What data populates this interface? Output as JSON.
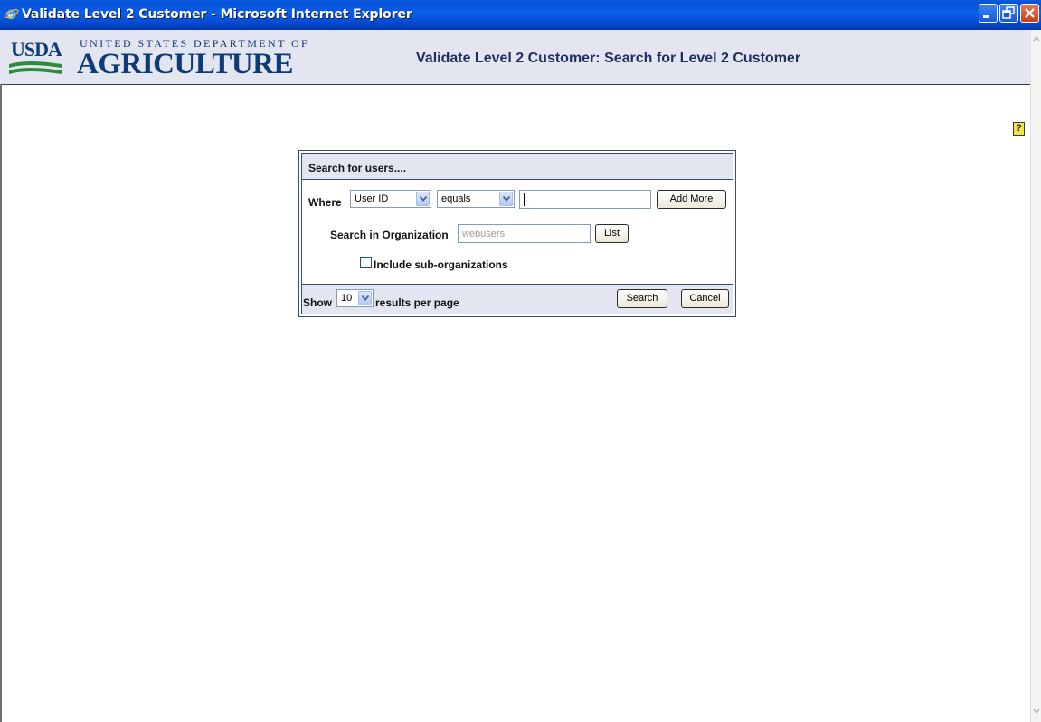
{
  "window": {
    "title": "Validate Level 2 Customer - Microsoft Internet Explorer"
  },
  "header": {
    "logo_usda": "USDA",
    "logo_dept": "UNITED STATES DEPARTMENT OF",
    "logo_agriculture": "AGRICULTURE",
    "page_title": "Validate Level 2 Customer: Search for Level 2 Customer"
  },
  "help": {
    "icon": "help-icon",
    "glyph": "?"
  },
  "search_panel": {
    "heading": "Search for users....",
    "where_label": "Where",
    "field_select": "User ID",
    "operator_select": "equals",
    "value_input": "",
    "add_more_label": "Add More",
    "org_label": "Search in Organization",
    "org_placeholder": "webusers",
    "list_label": "List",
    "include_sub_label": "Include sub-organizations",
    "include_sub_checked": false,
    "show_label": "Show",
    "per_page_value": "10",
    "per_page_suffix": "results per page",
    "search_label": "Search",
    "cancel_label": "Cancel"
  },
  "colors": {
    "titlebar": "#0551d7",
    "header_bg": "#e3e6f0",
    "title_text": "#1f2f5e",
    "usda_blue": "#0d3a78",
    "usda_green": "#2e8b3a"
  }
}
